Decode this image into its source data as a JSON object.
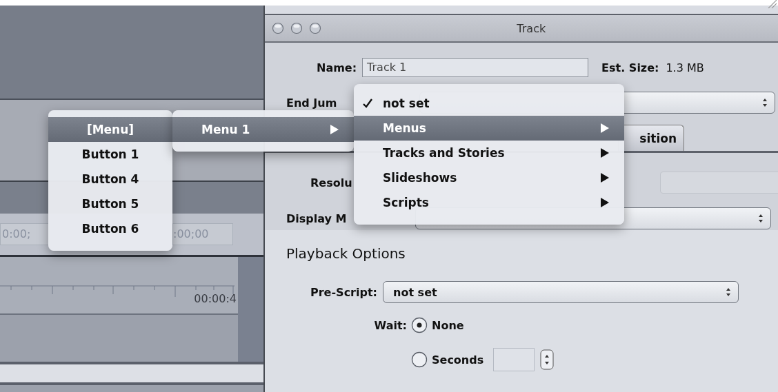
{
  "window": {
    "title": "Track"
  },
  "general": {
    "name_label": "Name:",
    "name_value": "Track 1",
    "size_label": "Est. Size:",
    "size_value": "1.3 MB",
    "end_jump_label": "End Jum"
  },
  "tabs": [
    {
      "label": "sition",
      "selected": false
    }
  ],
  "video": {
    "resolution_label": "Resolu",
    "resolution_disabled": true,
    "display_mode_label": "Display M"
  },
  "playback": {
    "title": "Playback Options",
    "pre_script_label": "Pre-Script:",
    "pre_script_value": "not set",
    "wait_label": "Wait:",
    "wait_options": [
      {
        "label": "None",
        "selected": true,
        "kind": "plain"
      },
      {
        "label": "Seconds",
        "selected": false,
        "kind": "seconds"
      }
    ]
  },
  "timeline": {
    "timecodes": [
      "0:00;",
      ":00;00"
    ],
    "ruler_label": "00:00:4"
  },
  "menus": [
    {
      "items": [
        {
          "label": "[Menu]",
          "selected": true,
          "submenu": false
        },
        {
          "label": "Button 1",
          "selected": false,
          "submenu": false
        },
        {
          "label": "Button 4",
          "selected": false,
          "submenu": false
        },
        {
          "label": "Button 5",
          "selected": false,
          "submenu": false
        },
        {
          "label": "Button 6",
          "selected": false,
          "submenu": false
        }
      ]
    },
    {
      "items": [
        {
          "label": "Menu 1",
          "selected": true,
          "submenu": true
        }
      ]
    },
    {
      "items": [
        {
          "label": "not set",
          "selected": false,
          "checked": true,
          "submenu": false
        },
        {
          "label": "Menus",
          "selected": true,
          "checked": false,
          "submenu": true
        },
        {
          "label": "Tracks and Stories",
          "selected": false,
          "checked": false,
          "submenu": true
        },
        {
          "label": "Slideshows",
          "selected": false,
          "checked": false,
          "submenu": true
        },
        {
          "label": "Scripts",
          "selected": false,
          "checked": false,
          "submenu": true
        }
      ]
    }
  ]
}
